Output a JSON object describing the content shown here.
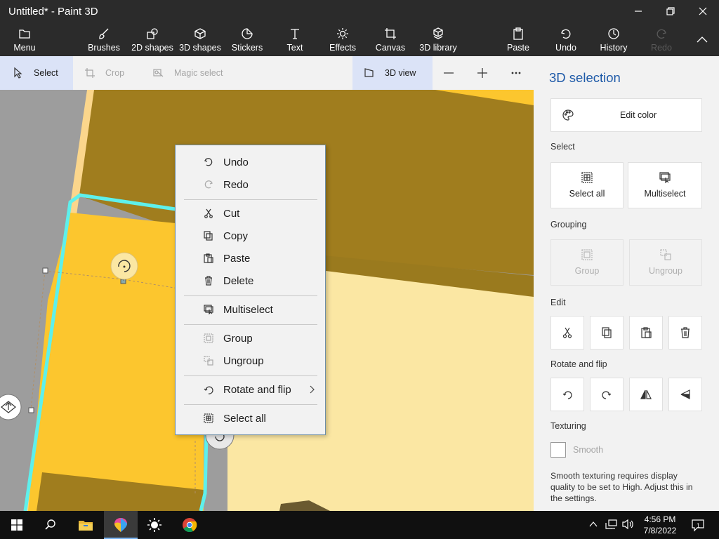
{
  "window": {
    "title": "Untitled* - Paint 3D"
  },
  "ribbon": {
    "menu": "Menu",
    "brushes": "Brushes",
    "shapes2d": "2D shapes",
    "shapes3d": "3D shapes",
    "stickers": "Stickers",
    "text": "Text",
    "effects": "Effects",
    "canvas": "Canvas",
    "library3d": "3D library",
    "paste": "Paste",
    "undo": "Undo",
    "history": "History",
    "redo": "Redo"
  },
  "toolbar": {
    "select": "Select",
    "crop": "Crop",
    "magic_select": "Magic select",
    "view3d": "3D view"
  },
  "context_menu": {
    "undo": "Undo",
    "redo": "Redo",
    "cut": "Cut",
    "copy": "Copy",
    "paste": "Paste",
    "delete": "Delete",
    "multiselect": "Multiselect",
    "group": "Group",
    "ungroup": "Ungroup",
    "rotate_flip": "Rotate and flip",
    "select_all": "Select all"
  },
  "panel": {
    "title": "3D selection",
    "edit_color": "Edit color",
    "select_label": "Select",
    "select_all": "Select all",
    "multiselect": "Multiselect",
    "grouping_label": "Grouping",
    "group": "Group",
    "ungroup": "Ungroup",
    "edit_label": "Edit",
    "rotate_label": "Rotate and flip",
    "texturing_label": "Texturing",
    "smooth": "Smooth",
    "note": "Smooth texturing requires display quality to be set to High. Adjust this in the settings."
  },
  "taskbar": {
    "time": "4:56 PM",
    "date": "7/8/2022",
    "notification_count": "1"
  },
  "colors": {
    "accent": "#1e5aa8",
    "object_yellow": "#fcc62e",
    "object_dark": "#a07d1e",
    "object_light": "#fbe7a3",
    "selection": "#5ef0ec"
  }
}
